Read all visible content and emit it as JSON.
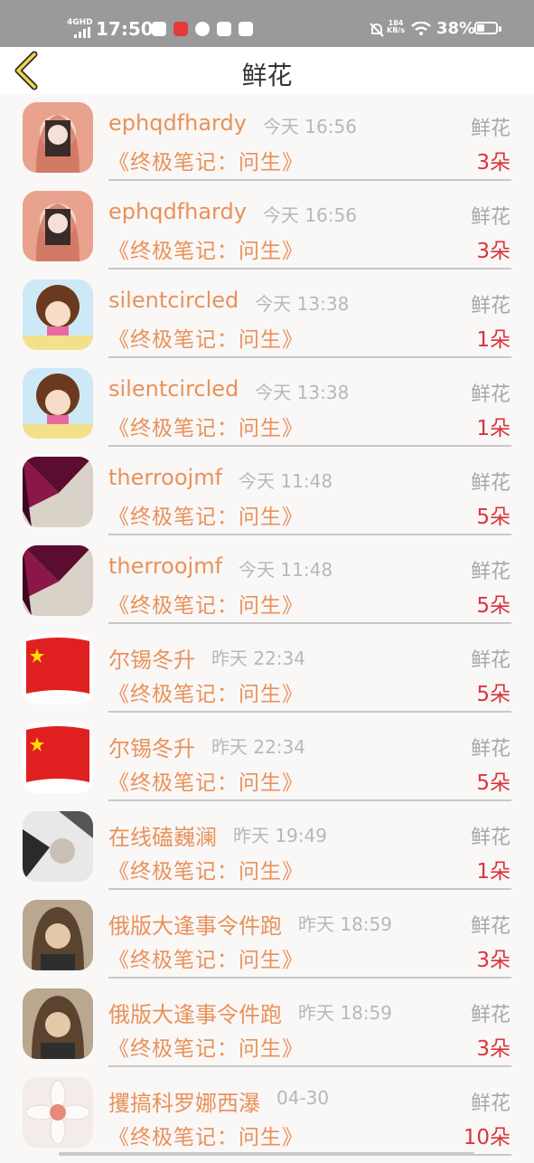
{
  "status_bar": {
    "network": "4GHD",
    "time": "17:50",
    "net_speed_value": "184",
    "net_speed_unit": "KB/s",
    "battery": "38%"
  },
  "header": {
    "title": "鲜花",
    "back_icon": "chevron-left-icon"
  },
  "rows": [
    {
      "name": "ephqdfhardy",
      "time": "今天 16:56",
      "book": "《终极笔记：问生》",
      "type": "鲜花",
      "count": "3朵"
    },
    {
      "name": "ephqdfhardy",
      "time": "今天 16:56",
      "book": "《终极笔记：问生》",
      "type": "鲜花",
      "count": "3朵"
    },
    {
      "name": "silentcircled",
      "time": "今天 13:38",
      "book": "《终极笔记：问生》",
      "type": "鲜花",
      "count": "1朵"
    },
    {
      "name": "silentcircled",
      "time": "今天 13:38",
      "book": "《终极笔记：问生》",
      "type": "鲜花",
      "count": "1朵"
    },
    {
      "name": "therroojmf",
      "time": "今天 11:48",
      "book": "《终极笔记：问生》",
      "type": "鲜花",
      "count": "5朵"
    },
    {
      "name": "therroojmf",
      "time": "今天 11:48",
      "book": "《终极笔记：问生》",
      "type": "鲜花",
      "count": "5朵"
    },
    {
      "name": "尔锡冬升",
      "time": "昨天 22:34",
      "book": "《终极笔记：问生》",
      "type": "鲜花",
      "count": "5朵"
    },
    {
      "name": "尔锡冬升",
      "time": "昨天 22:34",
      "book": "《终极笔记：问生》",
      "type": "鲜花",
      "count": "5朵"
    },
    {
      "name": "在线磕巍澜",
      "time": "昨天 19:49",
      "book": "《终极笔记：问生》",
      "type": "鲜花",
      "count": "1朵"
    },
    {
      "name": "俄版大逢事令件跑",
      "time": "昨天 18:59",
      "book": "《终极笔记：问生》",
      "type": "鲜花",
      "count": "3朵"
    },
    {
      "name": "俄版大逢事令件跑",
      "time": "昨天 18:59",
      "book": "《终极笔记：问生》",
      "type": "鲜花",
      "count": "3朵"
    },
    {
      "name": "攫搞科罗娜西瀑",
      "time": "04-30",
      "book": "《终极笔记：问生》",
      "type": "鲜花",
      "count": "10朵"
    }
  ]
}
